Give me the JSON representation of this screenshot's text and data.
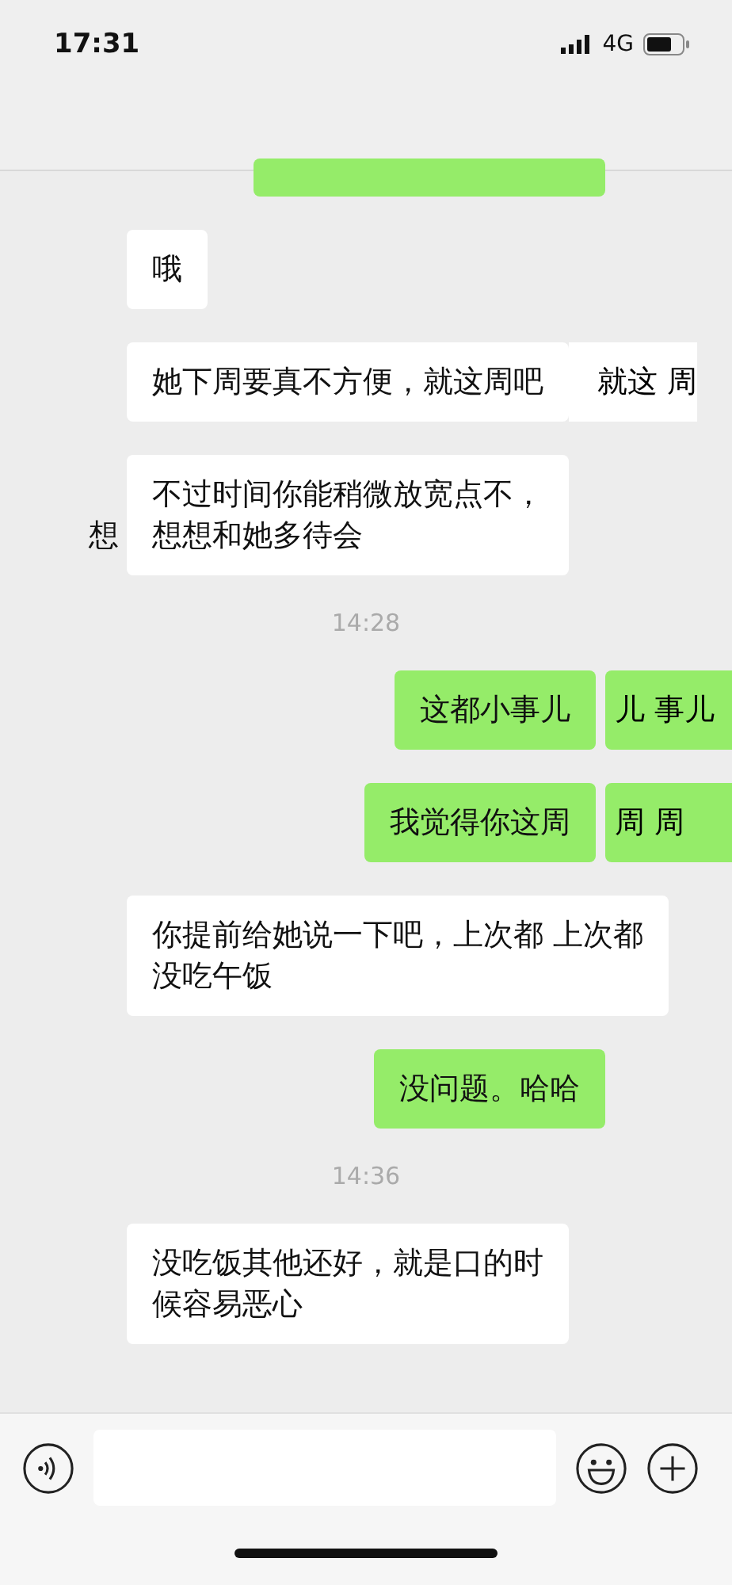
{
  "status_bar": {
    "time": "17:31",
    "network": "4G"
  },
  "messages": [
    {
      "kind": "sent"
    },
    {
      "kind": "received",
      "lines": [
        "哦"
      ]
    },
    {
      "kind": "received",
      "lines": [
        "她下周要真不方便，就这周吧"
      ],
      "fragment": "就这 周"
    },
    {
      "kind": "received",
      "lines": [
        "不过时间你能稍微放宽点不，",
        "想想和她多待会"
      ],
      "stray": "想"
    },
    {
      "kind": "time",
      "text": "14:28"
    },
    {
      "kind": "sent",
      "lines": [
        "这都小事儿"
      ],
      "fragment": "儿 事儿"
    },
    {
      "kind": "sent",
      "lines": [
        "我觉得你这周"
      ],
      "fragment": "周 周"
    },
    {
      "kind": "received",
      "lines": [
        "你提前给她说一下吧，上次都 上次都",
        "没吃午饭"
      ]
    },
    {
      "kind": "sent",
      "lines": [
        "没问题。哈哈"
      ]
    },
    {
      "kind": "time",
      "text": "14:36"
    },
    {
      "kind": "received",
      "lines": [
        "没吃饭其他还好，就是口的时",
        "候容易恶心"
      ]
    }
  ]
}
